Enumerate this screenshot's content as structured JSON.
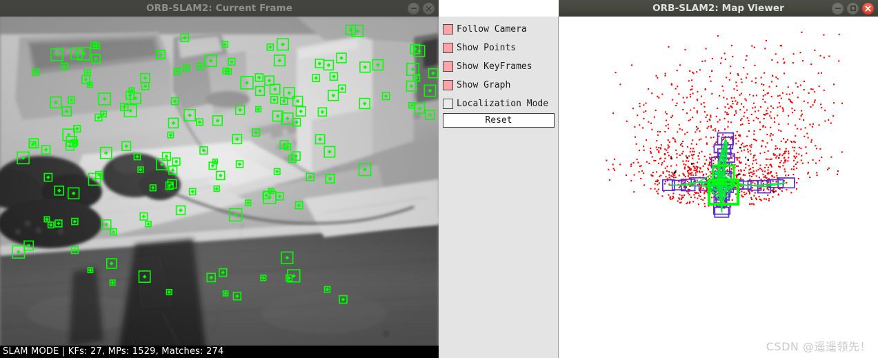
{
  "frame_window": {
    "title": "ORB-SLAM2: Current Frame",
    "window_buttons": [
      "minimize-icon",
      "close-icon"
    ],
    "status_bar": "SLAM MODE |  KFs: 27, MPs: 1529, Matches: 274",
    "stats": {
      "mode": "SLAM MODE",
      "keyframes": 27,
      "map_points": 1529,
      "matches": 274
    },
    "keypoint_color": "#00ff00",
    "keypoint_count_drawn": 148
  },
  "control_panel": {
    "checkboxes": [
      {
        "label": "Follow Camera",
        "checked": true
      },
      {
        "label": "Show Points",
        "checked": true
      },
      {
        "label": "Show KeyFrames",
        "checked": true
      },
      {
        "label": "Show Graph",
        "checked": true
      },
      {
        "label": "Localization Mode",
        "checked": false
      }
    ],
    "reset_label": "Reset",
    "checked_color": "#ffa3ab",
    "unchecked_color": "#ebebeb",
    "background_color": "#e4e4e4"
  },
  "map_window": {
    "title": "ORB-SLAM2: Map Viewer",
    "window_buttons": [
      "minimize-icon",
      "maximize-icon",
      "close-icon"
    ],
    "close_button_color": "#e0432b",
    "map_point_color": "#ff0000",
    "keyframe_color": "#5b2ed0",
    "graph_color": "#00e83c",
    "current_camera_color": "#00ff00",
    "background_color": "#ffffff"
  },
  "watermark": "CSDN @遥遥领先！"
}
